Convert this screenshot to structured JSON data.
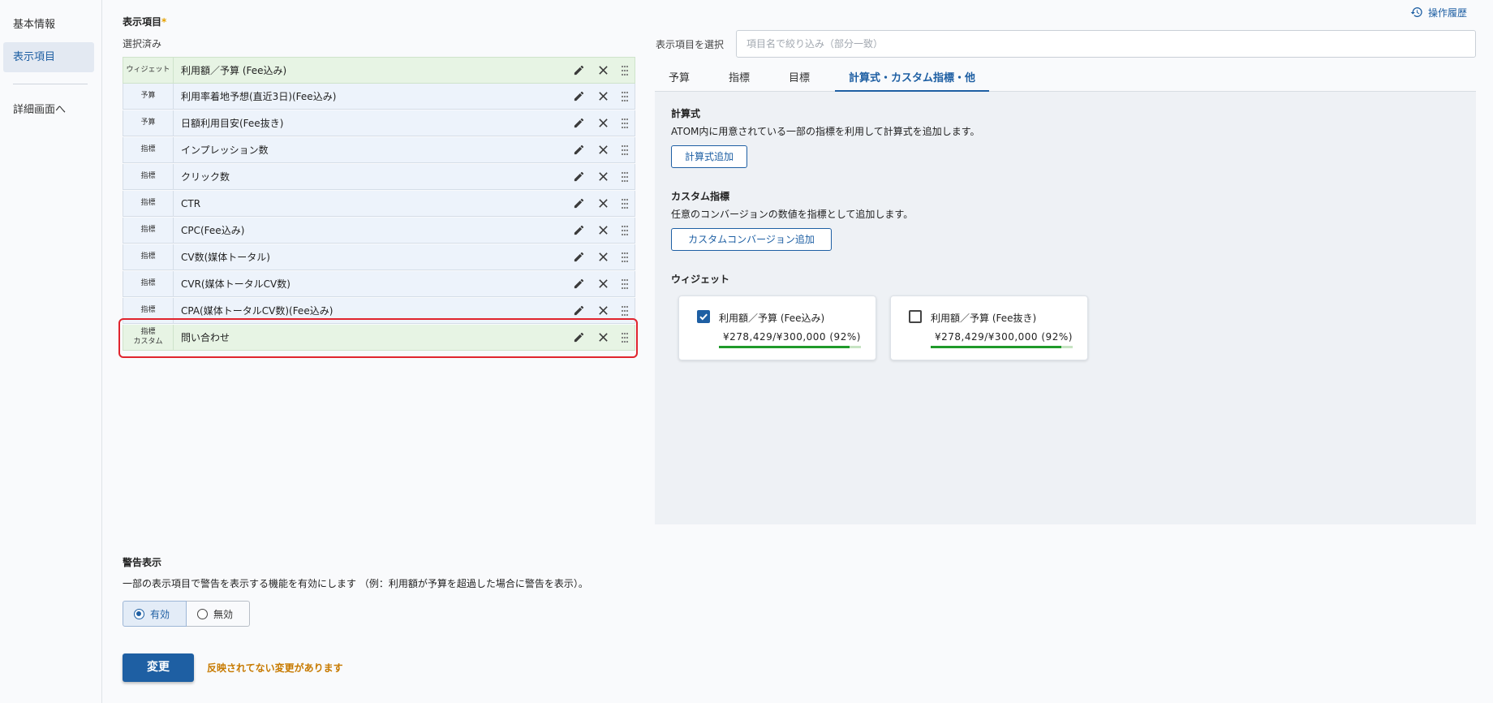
{
  "sidebar": {
    "items": [
      {
        "label": "基本情報"
      },
      {
        "label": "表示項目"
      },
      {
        "label": "詳細画面へ"
      }
    ]
  },
  "history": {
    "label": "操作履歴"
  },
  "display_items": {
    "title": "表示項目",
    "required_mark": "*",
    "selected_label": "選択済み",
    "rows": [
      {
        "tag": "ウィジェット",
        "name": "利用額／予算 (Fee込み)"
      },
      {
        "tag": "予算",
        "name": "利用率着地予想(直近3日)(Fee込み)"
      },
      {
        "tag": "予算",
        "name": "日額利用目安(Fee抜き)"
      },
      {
        "tag": "指標",
        "name": "インプレッション数"
      },
      {
        "tag": "指標",
        "name": "クリック数"
      },
      {
        "tag": "指標",
        "name": "CTR"
      },
      {
        "tag": "指標",
        "name": "CPC(Fee込み)"
      },
      {
        "tag": "指標",
        "name": "CV数(媒体トータル)"
      },
      {
        "tag": "指標",
        "name": "CVR(媒体トータルCV数)"
      },
      {
        "tag": "指標",
        "name": "CPA(媒体トータルCV数)(Fee込み)"
      },
      {
        "tag": "指標",
        "tag2": "カスタム",
        "name": "問い合わせ"
      }
    ]
  },
  "select": {
    "label": "表示項目を選択",
    "placeholder": "項目名で絞り込み（部分一致）",
    "tabs": [
      {
        "label": "予算"
      },
      {
        "label": "指標"
      },
      {
        "label": "目標"
      },
      {
        "label": "計算式・カスタム指標・他"
      }
    ],
    "formula": {
      "title": "計算式",
      "desc": "ATOM内に用意されている一部の指標を利用して計算式を追加します。",
      "button": "計算式追加"
    },
    "custom": {
      "title": "カスタム指標",
      "desc": "任意のコンバージョンの数値を指標として追加します。",
      "button": "カスタムコンバージョン追加"
    },
    "widget": {
      "title": "ウィジェット",
      "cards": [
        {
          "label": "利用額／予算 (Fee込み)",
          "value": "¥278,429/¥300,000 (92%)",
          "progress": 0.92,
          "checked": true
        },
        {
          "label": "利用額／予算 (Fee抜き)",
          "value": "¥278,429/¥300,000 (92%)",
          "progress": 0.92,
          "checked": false
        }
      ]
    }
  },
  "warning": {
    "title": "警告表示",
    "desc": "一部の表示項目で警告を表示する機能を有効にします （例：利用額が予算を超過した場合に警告を表示）。",
    "options": [
      {
        "label": "有効",
        "selected": true
      },
      {
        "label": "無効",
        "selected": false
      }
    ]
  },
  "submit": {
    "label": "変更",
    "unsaved_msg": "反映されてない変更があります"
  },
  "colors": {
    "accent": "#1e5fa3",
    "highlight": "#e0242e",
    "progress": "#1f9a2a",
    "warning_text": "#c77a00"
  }
}
